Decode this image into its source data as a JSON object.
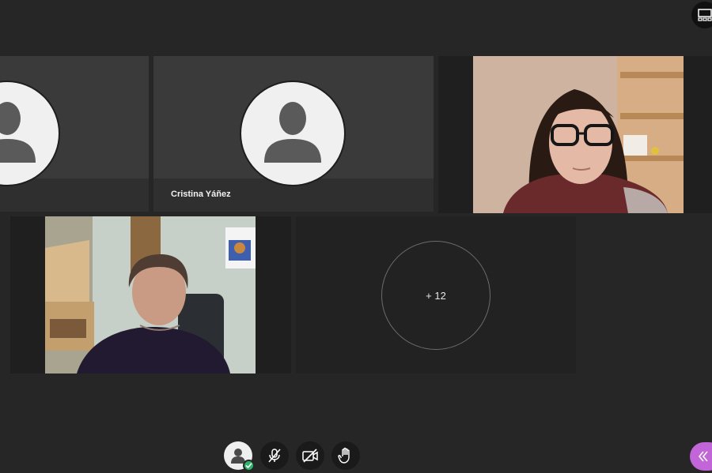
{
  "participants": [
    {
      "name": ""
    },
    {
      "name": "Cristina Yáñez"
    },
    {
      "name": ""
    },
    {
      "name": ""
    }
  ],
  "overflow": {
    "label": "+ 12"
  },
  "icons": {
    "layout": "layout-grid-icon",
    "avatar": "user-avatar-icon",
    "microphone": "microphone-muted-icon",
    "camera": "camera-off-icon",
    "hand": "raise-hand-icon",
    "panel": "double-chevron-left-icon"
  },
  "colors": {
    "background": "#262626",
    "tile": "#3a3a3a",
    "accent": "#c265d8",
    "status_ok": "#2fb26a"
  }
}
